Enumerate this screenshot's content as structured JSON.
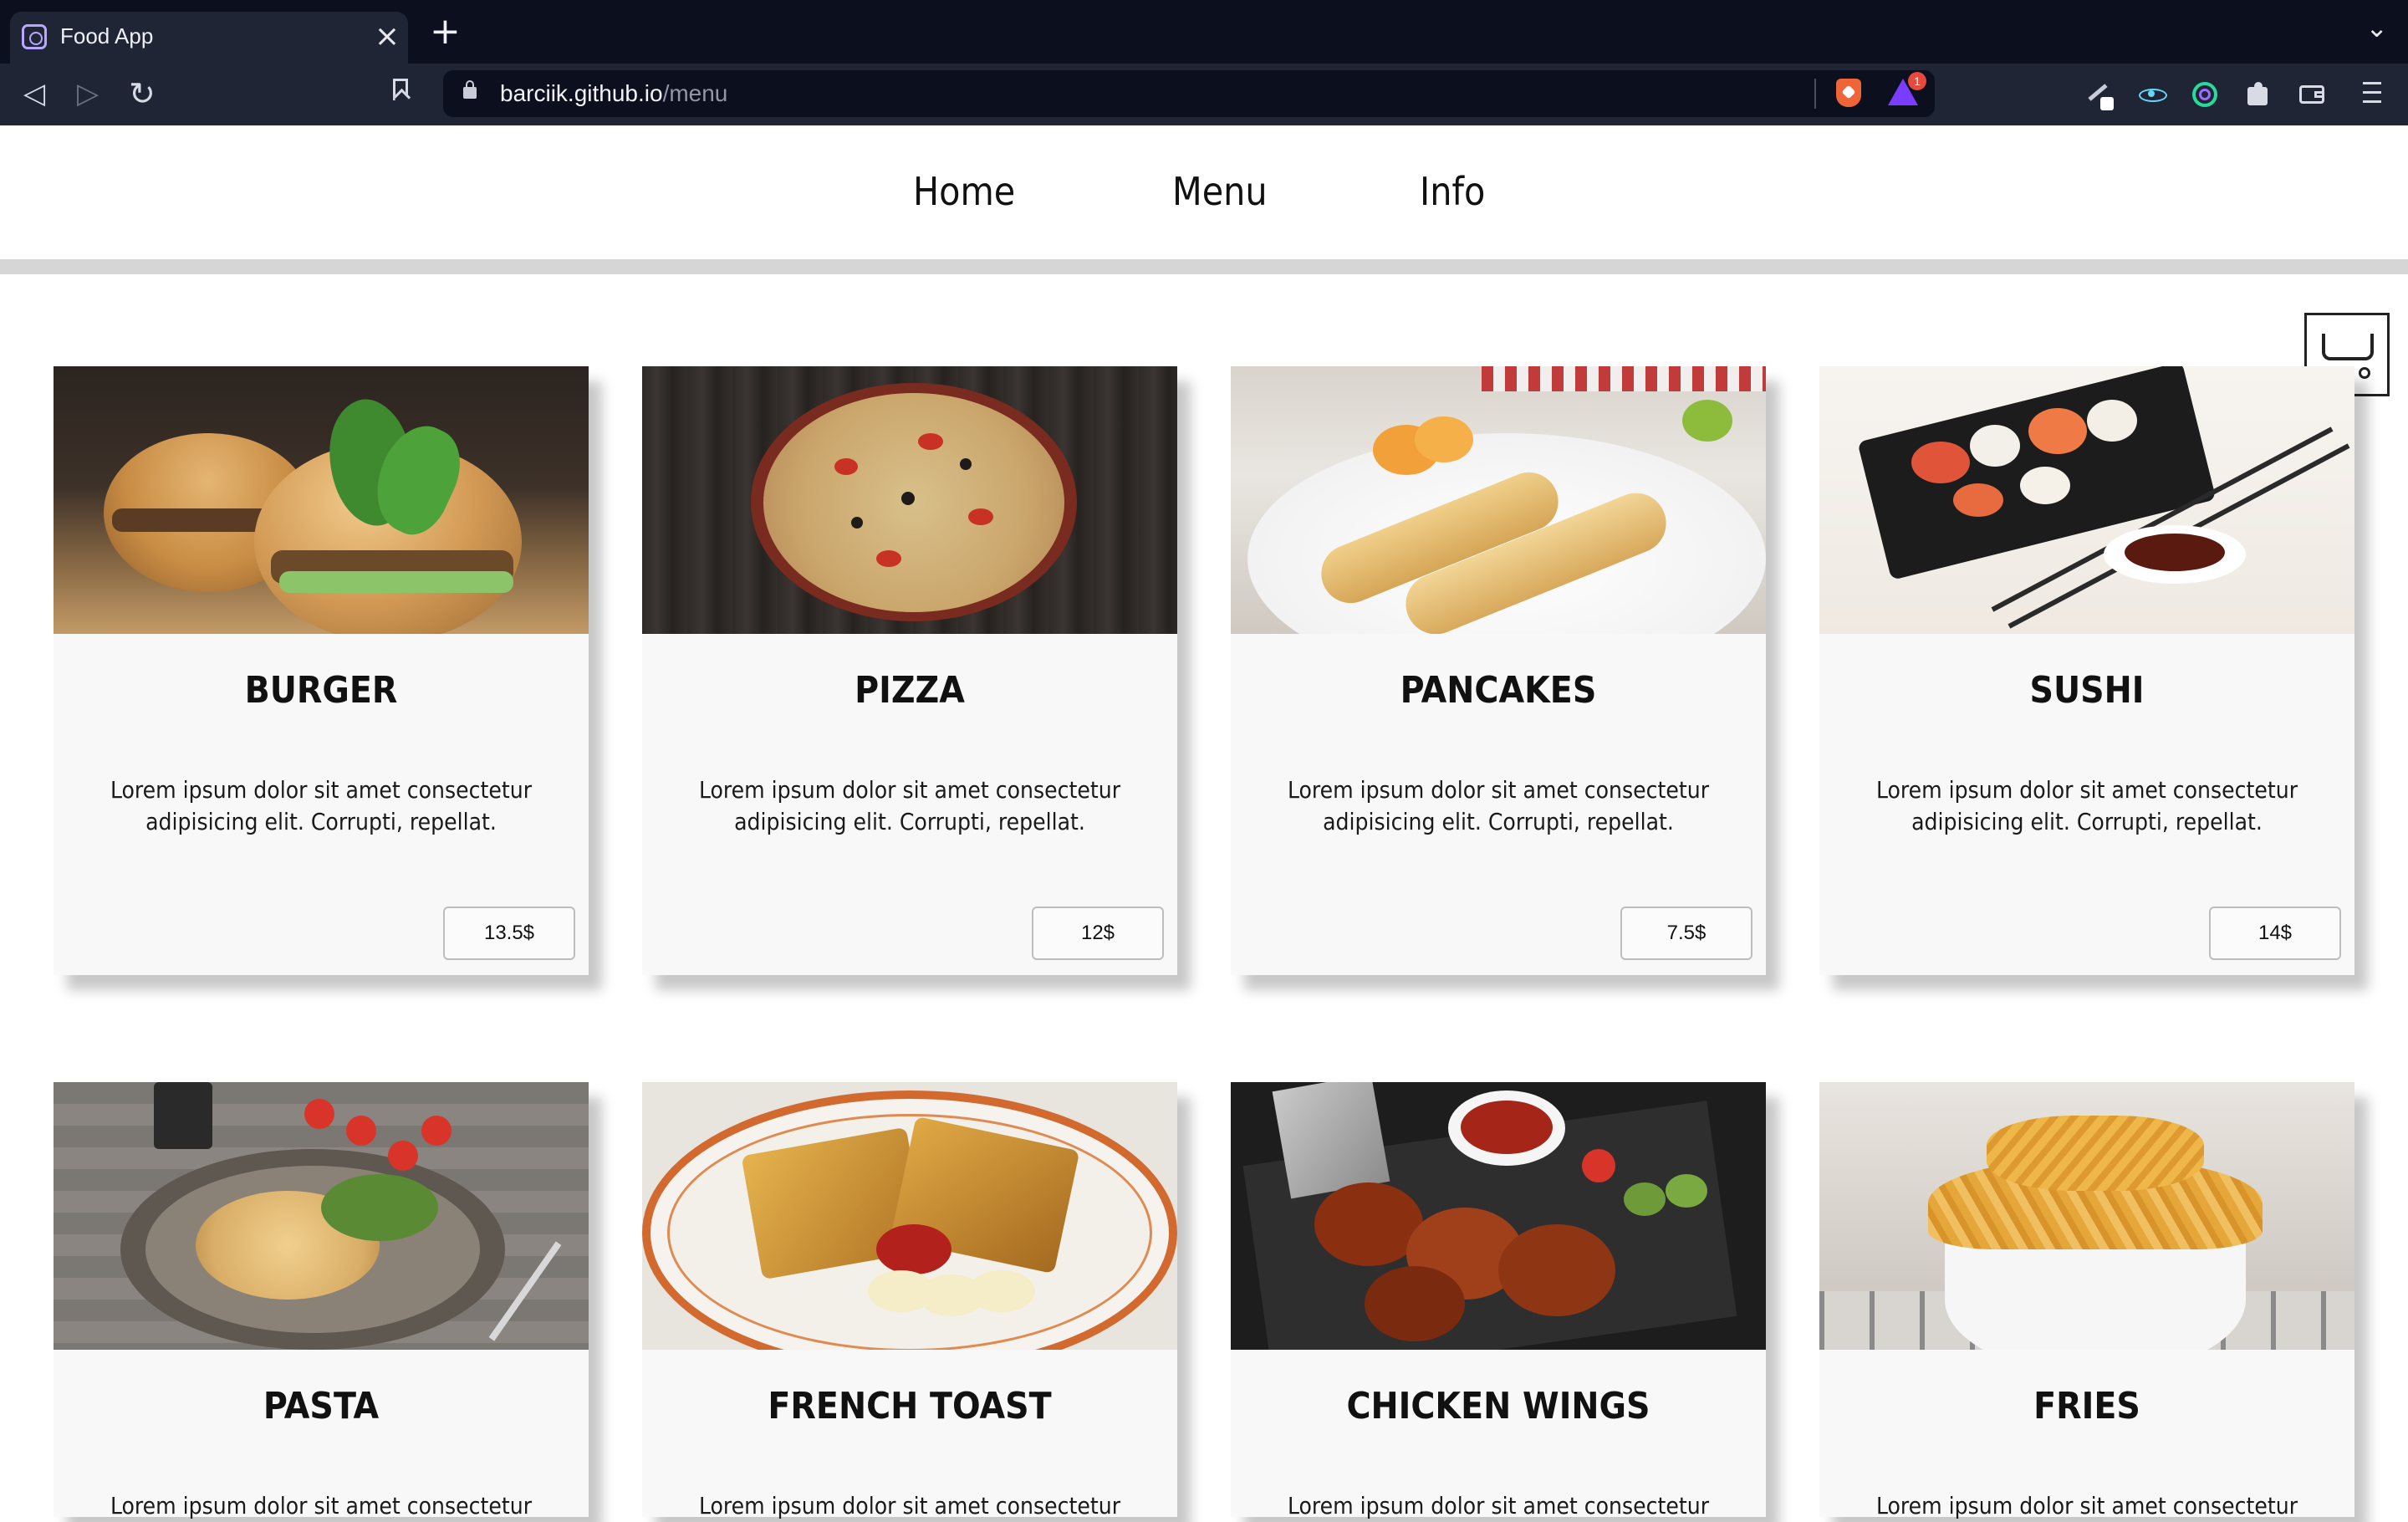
{
  "browser": {
    "tab_title": "Food App",
    "tab_close": "×",
    "new_tab": "+",
    "url_host": "barciik.github.io",
    "url_path": "/menu",
    "rewards_badge": "1"
  },
  "nav": {
    "links": [
      "Home",
      "Menu",
      "Info"
    ]
  },
  "cards": [
    {
      "title": "BURGER",
      "desc": "Lorem ipsum dolor sit amet consectetur adipisicing elit. Corrupti, repellat.",
      "price": "13.5$"
    },
    {
      "title": "PIZZA",
      "desc": "Lorem ipsum dolor sit amet consectetur adipisicing elit. Corrupti, repellat.",
      "price": "12$"
    },
    {
      "title": "PANCAKES",
      "desc": "Lorem ipsum dolor sit amet consectetur adipisicing elit. Corrupti, repellat.",
      "price": "7.5$"
    },
    {
      "title": "SUSHI",
      "desc": "Lorem ipsum dolor sit amet consectetur adipisicing elit. Corrupti, repellat.",
      "price": "14$"
    },
    {
      "title": "PASTA",
      "desc": "Lorem ipsum dolor sit amet consectetur"
    },
    {
      "title": "FRENCH TOAST",
      "desc": "Lorem ipsum dolor sit amet consectetur"
    },
    {
      "title": "CHICKEN WINGS",
      "desc": "Lorem ipsum dolor sit amet consectetur"
    },
    {
      "title": "FRIES",
      "desc": "Lorem ipsum dolor sit amet consectetur"
    }
  ]
}
